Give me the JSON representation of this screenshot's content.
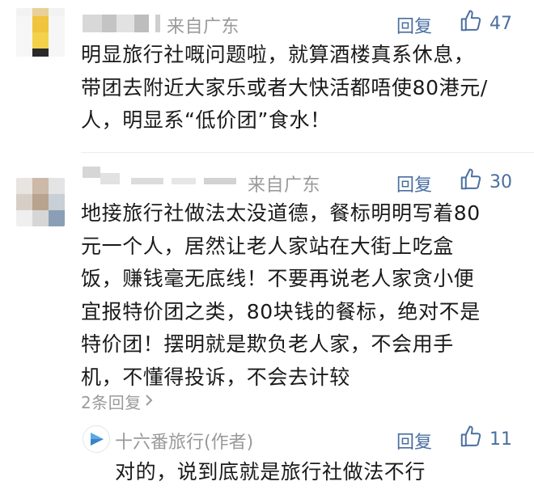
{
  "comments": [
    {
      "location": "来自广东",
      "reply_label": "回复",
      "likes": "47",
      "lines": [
        "明显旅行社嘅问题啦，就算酒楼真系休息，",
        "带团去附近大家乐或者大快活都唔使80港元/",
        "人，明显系“低价团”食水！"
      ]
    },
    {
      "location": "来自广东",
      "reply_label": "回复",
      "likes": "30",
      "lines": [
        "地接旅行社做法太没道德，餐标明明写着80",
        "元一个人，居然让老人家站在大街上吃盒",
        "饭，赚钱毫无底线！不要再说老人家贪小便",
        "宜报特价团之类，80块钱的餐标，绝对不是",
        "特价团！摆明就是欺负老人家，不会用手",
        "机，不懂得投诉，不会去计较"
      ],
      "replies_link": "2条回复",
      "author_reply": {
        "author": "十六番旅行(作者)",
        "reply_label": "回复",
        "likes": "11",
        "text": "对的，说到底就是旅行社做法不行"
      }
    }
  ],
  "icons": {
    "like": "thumbs-up-icon",
    "chevron": "chevron-right-icon",
    "author_avatar": "play-logo-icon"
  },
  "colors": {
    "link": "#4a6fa0",
    "muted": "#9a9a9a",
    "text": "#1a1a1a"
  }
}
